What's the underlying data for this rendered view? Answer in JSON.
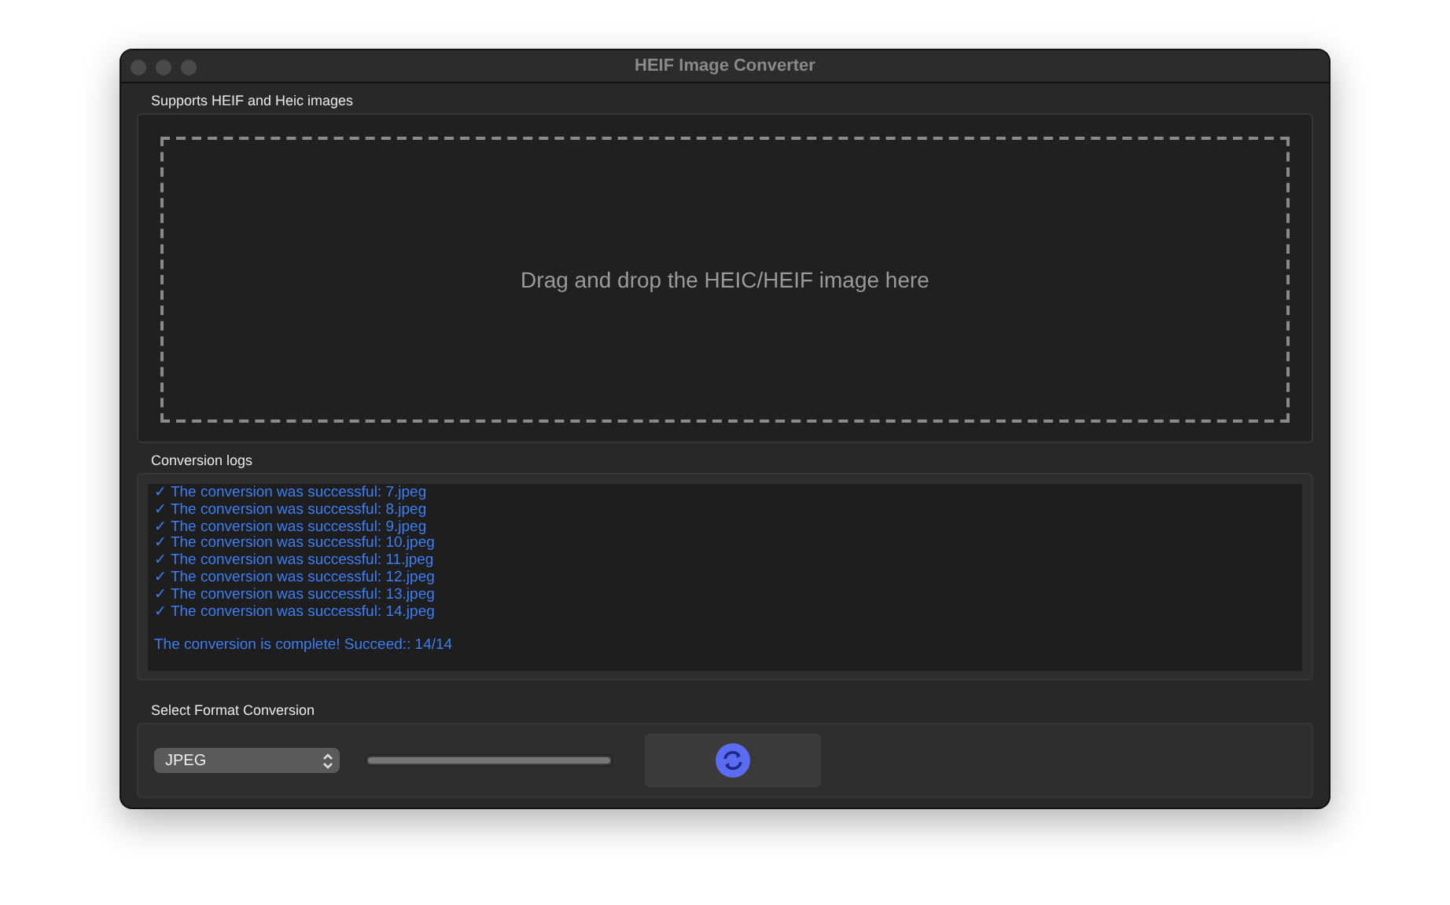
{
  "window": {
    "title": "HEIF Image Converter"
  },
  "drop_section": {
    "label": "Supports HEIF and Heic images",
    "hint": "Drag and drop the HEIC/HEIF image here"
  },
  "logs_section": {
    "label": "Conversion logs",
    "lines": [
      {
        "kind": "success",
        "text": "✓ The conversion was successful: 7.jpeg"
      },
      {
        "kind": "success",
        "text": "✓ The conversion was successful: 8.jpeg"
      },
      {
        "kind": "success",
        "text": "✓ The conversion was successful: 9.jpeg"
      },
      {
        "kind": "success",
        "text": "✓ The conversion was successful: 10.jpeg"
      },
      {
        "kind": "success",
        "text": "✓ The conversion was successful: 11.jpeg"
      },
      {
        "kind": "success",
        "text": "✓ The conversion was successful: 12.jpeg"
      },
      {
        "kind": "success",
        "text": "✓ The conversion was successful: 13.jpeg"
      },
      {
        "kind": "success",
        "text": "✓ The conversion was successful: 14.jpeg"
      },
      {
        "kind": "summary",
        "text": "The conversion is complete! Succeed:: 14/14"
      }
    ]
  },
  "format_section": {
    "label": "Select Format Conversion",
    "format": "JPEG",
    "progress": {
      "level": 1
    }
  }
}
